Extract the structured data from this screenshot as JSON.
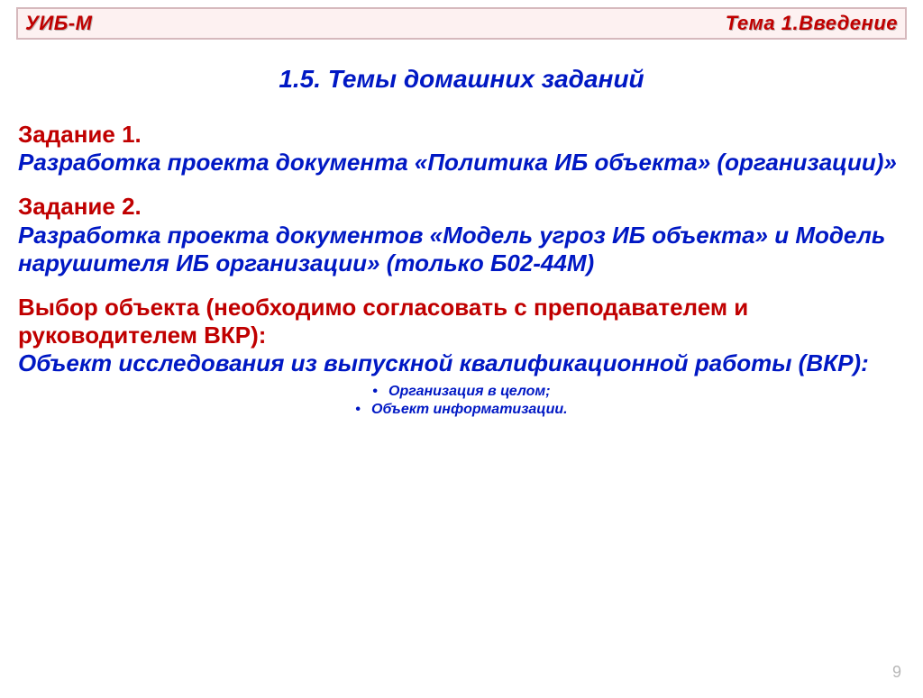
{
  "header": {
    "left": "УИБ-М",
    "right": "Тема 1.Введение"
  },
  "title": "1.5. Темы домашних заданий",
  "task1": {
    "heading": "Задание 1.",
    "body": "Разработка проекта документа «Политика ИБ объекта» (организации)»"
  },
  "task2": {
    "heading": "Задание 2.",
    "body": "Разработка проекта документов  «Модель  угроз ИБ объекта»  и Модель нарушителя ИБ организации» (только Б02-44М)"
  },
  "choice": {
    "heading": "Выбор объекта (необходимо согласовать с преподавателем и руководителем ВКР):",
    "body": "Объект исследования из выпускной квалификационной работы (ВКР):"
  },
  "bullets": [
    "Организация в целом;",
    "Объект информатизации."
  ],
  "page_number": "9"
}
